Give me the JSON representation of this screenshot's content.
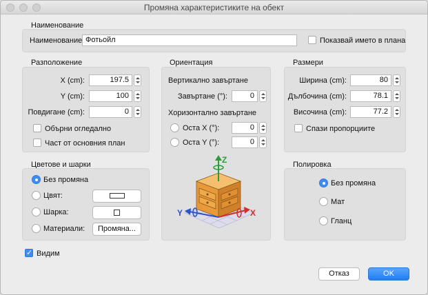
{
  "window": {
    "title": "Промяна характеристиките на обект"
  },
  "naming": {
    "section_title": "Наименование",
    "name_label": "Наименование:",
    "name_value": "Фотьойл",
    "show_name_label": "Показвай името в плана",
    "show_name_checked": false
  },
  "position": {
    "section_title": "Разположение",
    "x_label": "X (cm):",
    "x_value": "197.5",
    "y_label": "Y (cm):",
    "y_value": "100",
    "elevation_label": "Повдигане (cm):",
    "elevation_value": "0",
    "mirror_label": "Обърни огледално",
    "mirror_checked": false,
    "basePlan_label": "Част от основния план",
    "basePlan_checked": false
  },
  "orientation": {
    "section_title": "Ориентация",
    "vertical_title": "Вертикално завъртане",
    "rotation_label": "Завъртане (°):",
    "rotation_value": "0",
    "horizontal_title": "Хоризонтално завъртане",
    "axis_x_label": "Оста X (°):",
    "axis_x_value": "0",
    "axis_y_label": "Оста Y (°):",
    "axis_y_value": "0",
    "axis_labels": {
      "z": "Z",
      "y": "Y",
      "x": "X"
    }
  },
  "size": {
    "section_title": "Размери",
    "width_label": "Ширина (cm):",
    "width_value": "80",
    "depth_label": "Дълбочина (cm):",
    "depth_value": "78.1",
    "height_label": "Височина (cm):",
    "height_value": "77.2",
    "keep_proportions_label": "Спази пропорциите",
    "keep_proportions_checked": false
  },
  "colors": {
    "section_title": "Цветове и шарки",
    "unchanged_label": "Без промяна",
    "color_label": "Цвят:",
    "texture_label": "Шарка:",
    "materials_label": "Материали:",
    "materials_button": "Промяна...",
    "selected": "unchanged"
  },
  "shininess": {
    "section_title": "Полировка",
    "unchanged_label": "Без промяна",
    "matt_label": "Мат",
    "shiny_label": "Гланц",
    "selected": "unchanged"
  },
  "visible": {
    "label": "Видим",
    "checked": true
  },
  "buttons": {
    "cancel": "Отказ",
    "ok": "OK"
  },
  "colors_theme": {
    "accent": "#3d8cf5",
    "x_axis": "#d0302a",
    "y_axis": "#2a52c9",
    "z_axis": "#2e9b3a"
  }
}
